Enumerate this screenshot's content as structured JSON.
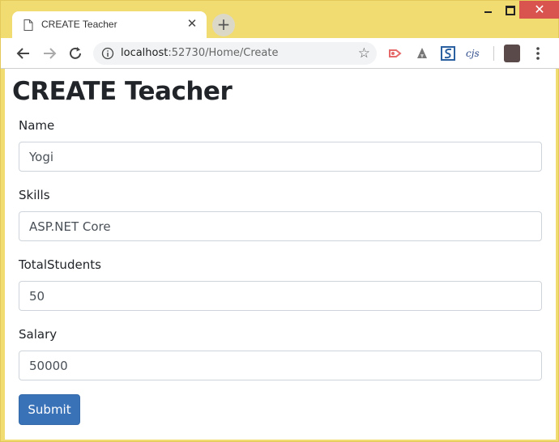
{
  "browser": {
    "tab_title": "CREATE Teacher",
    "tab_close": "✕",
    "new_tab": "+",
    "url_host": "localhost",
    "url_path": ":52730/Home/Create",
    "extension_cjs": "cjs",
    "close_window": "✕"
  },
  "page": {
    "title": "CREATE Teacher",
    "fields": [
      {
        "label": "Name",
        "value": "Yogi"
      },
      {
        "label": "Skills",
        "value": "ASP.NET Core"
      },
      {
        "label": "TotalStudents",
        "value": "50"
      },
      {
        "label": "Salary",
        "value": "50000"
      }
    ],
    "submit_label": "Submit"
  },
  "colors": {
    "window_frame": "#f1dc71",
    "close_button": "#d9534f",
    "primary_button": "#3a72b8"
  },
  "icons": {
    "tab": "document-icon",
    "back": "arrow-left-icon",
    "forward": "arrow-right-icon",
    "reload": "reload-icon",
    "site_info": "info-icon",
    "bookmark": "star-icon",
    "menu": "three-dots-vertical-icon"
  }
}
